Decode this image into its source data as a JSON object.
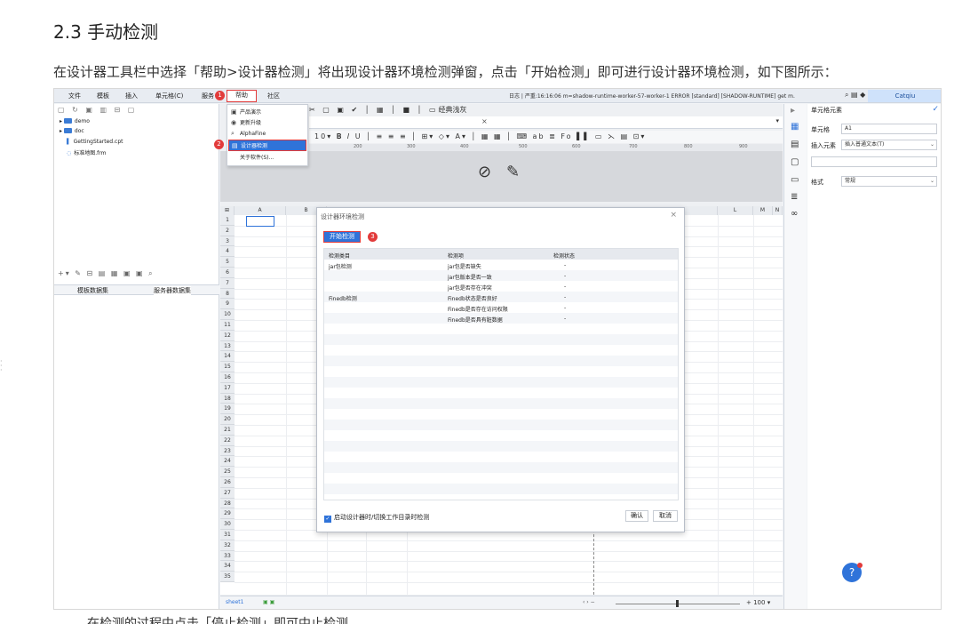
{
  "doc": {
    "heading": "2.3 手动检测",
    "paragraph": "在设计器工具栏中选择「帮助>设计器检测」将出现设计器环境检测弹窗，点击「开始检测」即可进行设计器环境检测，如下图所示：",
    "cutoff_text": "在检测的过程中点击「停止检测」即可中止检测。"
  },
  "menubar": {
    "items": [
      "文件",
      "模板",
      "插入",
      "单元格(C)",
      "服务"
    ],
    "help": "帮助",
    "community": "社区",
    "log": "日志 | 严重:16:16:06 m=shadow-runtime-worker-57-worker-1 ERROR [standard] [SHADOW-RUNTIME] get m.",
    "user": "Catqiu"
  },
  "badges": [
    "1",
    "2",
    "3"
  ],
  "left_panel": {
    "tree": [
      {
        "label": "demo",
        "type": "folder"
      },
      {
        "label": "doc",
        "type": "folder"
      },
      {
        "label": "GettingStarted.cpt",
        "type": "file"
      },
      {
        "label": "标准地图.frm",
        "type": "file"
      }
    ],
    "tabs": [
      "模板数据集",
      "服务器数据集"
    ]
  },
  "help_menu": {
    "items": [
      "产品演示",
      "更新升级",
      "AlphaFine",
      "设计器检测",
      "关于软件(S)..."
    ]
  },
  "designer": {
    "example_tab": "经典浅灰",
    "font_size": "10",
    "ruler": [
      "200",
      "300",
      "400",
      "500",
      "600",
      "700",
      "800",
      "900"
    ],
    "columns": [
      "A",
      "B",
      "L",
      "M",
      "N"
    ],
    "rows": [
      "1",
      "2",
      "3",
      "4",
      "5",
      "6",
      "7",
      "8",
      "9",
      "10",
      "11",
      "12",
      "13",
      "14",
      "15",
      "16",
      "17",
      "18",
      "19",
      "20",
      "21",
      "22",
      "23",
      "24",
      "25",
      "26",
      "27",
      "28",
      "29",
      "30",
      "31",
      "32",
      "33",
      "34",
      "35"
    ],
    "sheet": "sheet1",
    "zoom": "100"
  },
  "dialog": {
    "title": "设计器环境检测",
    "start_button": "开始检测",
    "headers": [
      "检测类目",
      "检测项",
      "检测状态"
    ],
    "rows": [
      {
        "category": "jar包检测",
        "item": "jar包是否缺失",
        "status": "-"
      },
      {
        "category": "",
        "item": "jar包版本是否一致",
        "status": "-"
      },
      {
        "category": "",
        "item": "jar包是否存在冲突",
        "status": "-"
      },
      {
        "category": "Finedb检测",
        "item": "Finedb状态是否良好",
        "status": "-"
      },
      {
        "category": "",
        "item": "Finedb是否存在访问权限",
        "status": "-"
      },
      {
        "category": "",
        "item": "Finedb是否具有脏数据",
        "status": "-"
      }
    ],
    "checkbox_label": "启动设计器时/切换工作目录时检测",
    "ok": "确认",
    "cancel": "取消"
  },
  "right_panel": {
    "title": "单元格元素",
    "cell_label": "单元格",
    "cell_value": "A1",
    "insert_label": "插入元素",
    "insert_value": "插入普通文本(T)",
    "format_label": "格式",
    "format_value": "常规"
  },
  "icons": [
    "copy-icon",
    "refresh-icon",
    "search-icon",
    "eye-off-icon",
    "pencil-icon",
    "help-icon",
    "check-icon",
    "close-icon"
  ],
  "colors": {
    "accent": "#2f73d9",
    "highlight": "#e23b3b"
  }
}
